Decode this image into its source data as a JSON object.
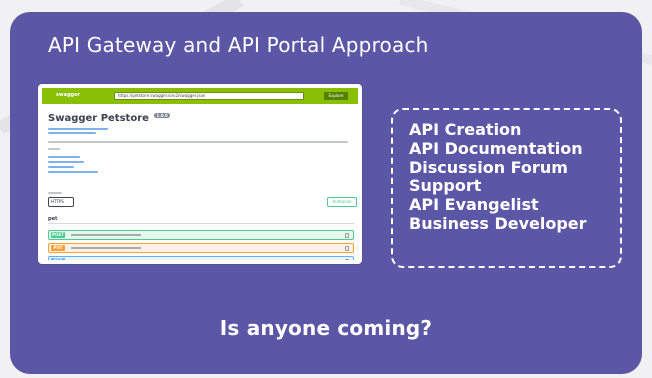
{
  "title": "API Gateway and API Portal Approach",
  "screenshot": {
    "logo": "swagger",
    "url": "https://petstore.swagger.io/v2/swagger.json",
    "explore_label": "Explore",
    "api_title": "Swagger Petstore",
    "api_version": "1.0.0",
    "scheme": "HTTPS",
    "authorize_label": "Authorize",
    "tag": "pet",
    "operations": [
      {
        "method": "POST"
      },
      {
        "method": "PUT"
      },
      {
        "method": "GET"
      }
    ]
  },
  "list_items": [
    "API Creation",
    "API Documentation",
    "Discussion Forum",
    "Support",
    "API Evangelist",
    "Business Developer"
  ],
  "question": "Is anyone coming?",
  "colors": {
    "card_background": "#5b57a6",
    "page_background": "#f1f1f3",
    "text": "#ffffff",
    "swagger_green": "#89bf04"
  }
}
